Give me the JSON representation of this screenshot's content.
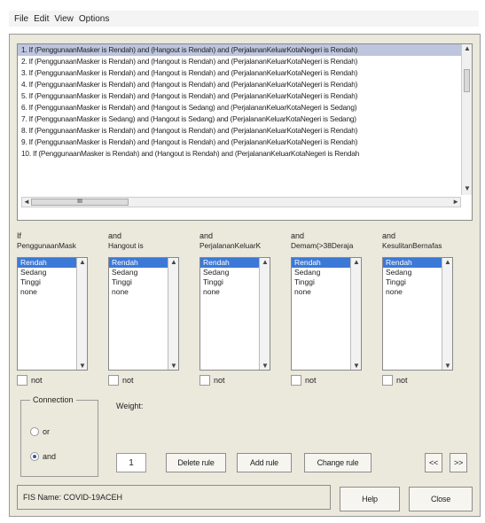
{
  "menu": {
    "items": [
      "File",
      "Edit",
      "View",
      "Options"
    ]
  },
  "rules": [
    "1. If (PenggunaanMasker is Rendah) and (Hangout is Rendah) and (PerjalananKeluarKotaNegeri is Rendah)",
    "2. If (PenggunaanMasker is Rendah) and (Hangout is Rendah) and (PerjalananKeluarKotaNegeri is Rendah)",
    "3. If (PenggunaanMasker is Rendah) and (Hangout is Rendah) and (PerjalananKeluarKotaNegeri is Rendah)",
    "4. If (PenggunaanMasker is Rendah) and (Hangout is Rendah) and (PerjalananKeluarKotaNegeri is Rendah)",
    "5. If (PenggunaanMasker is Rendah) and (Hangout is Rendah) and (PerjalananKeluarKotaNegeri is Rendah)",
    "6. If (PenggunaanMasker is Rendah) and (Hangout is Sedang) and (PerjalananKeluarKotaNegeri is Sedang)",
    "7. If (PenggunaanMasker is Sedang) and (Hangout is Sedang) and (PerjalananKeluarKotaNegeri is Sedang)",
    "8. If (PenggunaanMasker is Rendah) and (Hangout is Rendah) and (PerjalananKeluarKotaNegeri is Rendah)",
    "9. If (PenggunaanMasker is Rendah) and (Hangout is Rendah) and (PerjalananKeluarKotaNegeri is Rendah)",
    "10. If (PenggunaanMasker is Rendah) and (Hangout is Rendah) and (PerjalananKeluarKotaNegeri is Rendah"
  ],
  "hscroll_label": "III",
  "antecedents": [
    {
      "keyword": "If",
      "variable": "PenggunaanMask",
      "options": [
        "Rendah",
        "Sedang",
        "Tinggi",
        "none"
      ],
      "selected": "Rendah",
      "not_label": "not"
    },
    {
      "keyword": "and",
      "variable": "Hangout is",
      "options": [
        "Rendah",
        "Sedang",
        "Tinggi",
        "none"
      ],
      "selected": "Rendah",
      "not_label": "not"
    },
    {
      "keyword": "and",
      "variable": "PerjalananKeluarK",
      "options": [
        "Rendah",
        "Sedang",
        "Tinggi",
        "none"
      ],
      "selected": "Rendah",
      "not_label": "not"
    },
    {
      "keyword": "and",
      "variable": "Demam(>38Deraja",
      "options": [
        "Rendah",
        "Sedang",
        "Tinggi",
        "none"
      ],
      "selected": "Rendah",
      "not_label": "not"
    },
    {
      "keyword": "and",
      "variable": "KesulitanBernafas",
      "options": [
        "Rendah",
        "Sedang",
        "Tinggi",
        "none"
      ],
      "selected": "Rendah",
      "not_label": "not"
    }
  ],
  "connection": {
    "title": "Connection",
    "options": [
      "or",
      "and"
    ],
    "selected": "and"
  },
  "weight": {
    "label": "Weight:",
    "value": "1"
  },
  "buttons": {
    "delete_rule": "Delete rule",
    "add_rule": "Add rule",
    "change_rule": "Change rule",
    "prev": "<<",
    "next": ">>",
    "help": "Help",
    "close": "Close"
  },
  "status": {
    "fis_name": "FIS Name: COVID-19ACEH"
  },
  "colors": {
    "selection": "#3c79d6",
    "frame": "#ebe8dc",
    "list_highlight": "#bdc6de"
  }
}
